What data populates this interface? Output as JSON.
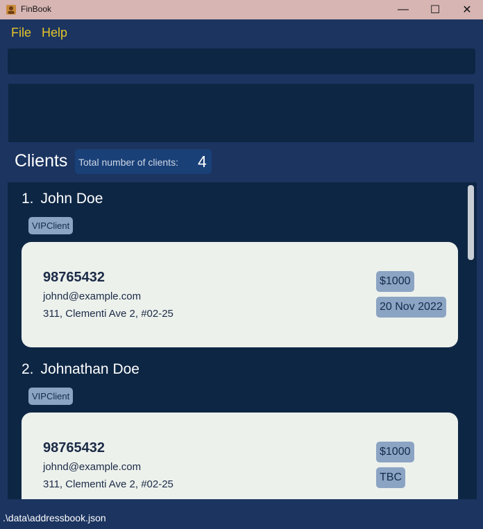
{
  "window": {
    "title": "FinBook",
    "min_glyph": "—",
    "max_glyph": "☐",
    "close_glyph": "✕"
  },
  "menu": {
    "file": "File",
    "help": "Help"
  },
  "command_box": {
    "value": ""
  },
  "result_box": {
    "text": ""
  },
  "clients": {
    "title": "Clients",
    "count_label": "Total number of clients:",
    "count": "4"
  },
  "client_list": [
    {
      "index": "1.",
      "name": "John Doe",
      "tag": "VIPClient",
      "phone": "98765432",
      "email": "johnd@example.com",
      "address": "311, Clementi Ave 2, #02-25",
      "amount": "$1000",
      "date": "20 Nov 2022"
    },
    {
      "index": "2.",
      "name": "Johnathan Doe",
      "tag": "VIPClient",
      "phone": "98765432",
      "email": "johnd@example.com",
      "address": "311, Clementi Ave 2, #02-25",
      "amount": "$1000",
      "date": "TBC"
    }
  ],
  "status_bar": {
    "path": ".\\data\\addressbook.json"
  },
  "colors": {
    "background": "#1b3460",
    "panel": "#0d2644",
    "menu_text": "#e4c52b",
    "tag": "#8ba4c3",
    "card": "#edf1ec",
    "titlebar": "#d7b5b3"
  }
}
